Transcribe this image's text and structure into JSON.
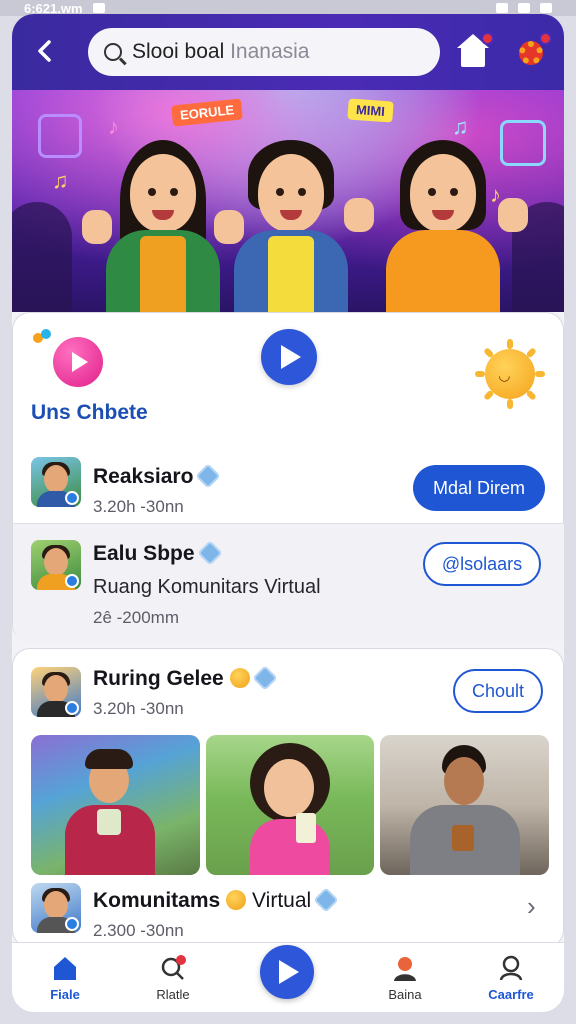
{
  "status_bar": {
    "time": "6:621.wm"
  },
  "header": {
    "search_value": "Slooi boal",
    "search_placeholder": "Inanasia"
  },
  "hero": {
    "sign_left": "EORULE",
    "sign_right": "MIMI"
  },
  "card1": {
    "section_title": "Uns Chbete",
    "row1": {
      "title": "Reaksiaro",
      "subtitle": "3.20h -30nn",
      "button": "Mdal Direm"
    },
    "row2": {
      "title": "Ealu Sbpe",
      "description": "Ruang Komunitars Virtual",
      "subtitle": "2ê -200mm",
      "button": "@lsolaars"
    }
  },
  "card2": {
    "row1": {
      "title": "Ruring Gelee",
      "subtitle": "3.20h -30nn",
      "button": "Choult"
    },
    "row2": {
      "title": "Komunitams",
      "title_suffix": "Virtual",
      "subtitle": "2.300 -30nn"
    }
  },
  "bottom_nav": {
    "items": [
      {
        "label": "Fiale",
        "icon": "home-icon"
      },
      {
        "label": "Rlatle",
        "icon": "search-notification-icon"
      },
      {
        "label": "Baina",
        "icon": "person-icon"
      },
      {
        "label": "Caarfre",
        "icon": "profile-icon"
      }
    ]
  },
  "colors": {
    "primary": "#1f56d3",
    "header": "#4a2bb5",
    "badge": "#e33240"
  }
}
